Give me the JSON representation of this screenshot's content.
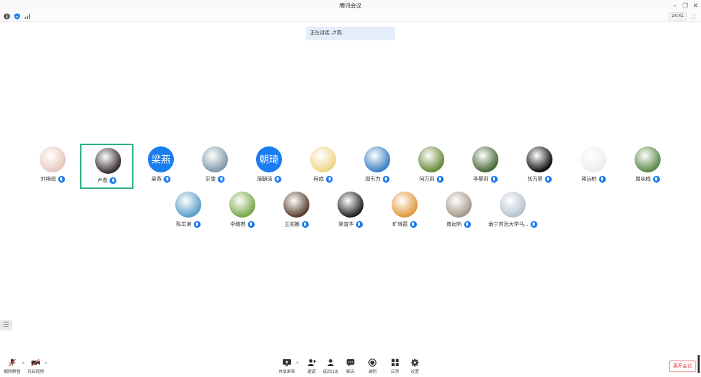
{
  "window": {
    "title": "腾讯会议"
  },
  "status": {
    "timer": "24:41"
  },
  "speaking": {
    "text": "正在讲话: 卢燕;"
  },
  "participants": [
    {
      "name": "刘艳闻",
      "avatar": "photo-dolls",
      "color": "#e9c9bf"
    },
    {
      "name": "卢燕",
      "avatar": "photo-dark-red",
      "color": "#3a3030",
      "active": true
    },
    {
      "name": "梁燕",
      "avatar_text": "梁燕",
      "color": "#1a7df0"
    },
    {
      "name": "宋雪",
      "avatar": "photo-landscape",
      "color": "#7f9aa8"
    },
    {
      "name": "蒲朝琦",
      "avatar_text": "朝琦",
      "color": "#1a7df0"
    },
    {
      "name": "程成",
      "avatar": "photo-cartoon",
      "color": "#f1d68a"
    },
    {
      "name": "周韦力",
      "avatar": "photo-sky",
      "color": "#3b82c4"
    },
    {
      "name": "何万莉",
      "avatar": "photo-flower-yellow",
      "color": "#6b8a3a"
    },
    {
      "name": "李曼莉",
      "avatar": "photo-white-flower",
      "color": "#4a6a3a"
    },
    {
      "name": "张万景",
      "avatar": "qq-penguin-icon",
      "color": "#111111"
    },
    {
      "name": "蒋远柏",
      "avatar": "photo-sketch",
      "color": "#eeeeee"
    },
    {
      "name": "周咏梅",
      "avatar": "photo-berries",
      "color": "#5c8a4a"
    },
    {
      "name": "陈军弟",
      "avatar": "photo-beach",
      "color": "#5aa0c8"
    },
    {
      "name": "李瑞君",
      "avatar": "photo-tree",
      "color": "#7aa84a"
    },
    {
      "name": "王丽娜",
      "avatar": "photo-portrait",
      "color": "#5a4030"
    },
    {
      "name": "莫雪华",
      "avatar": "photo-door",
      "color": "#222222"
    },
    {
      "name": "旷晓霞",
      "avatar": "photo-sunset",
      "color": "#e09a40"
    },
    {
      "name": "周起帆",
      "avatar": "photo-books",
      "color": "#a89a8a"
    },
    {
      "name": "南宁师范大学马...",
      "avatar": "photo-building",
      "color": "#b8c4d0"
    }
  ],
  "toolbar": {
    "unmute": "解除静音",
    "start_video": "开启视频",
    "share_screen": "共享屏幕",
    "invite": "邀请",
    "members": "成员(19)",
    "chat": "聊天",
    "record": "录制",
    "apps": "应用",
    "settings": "设置",
    "leave": "离开会议"
  }
}
